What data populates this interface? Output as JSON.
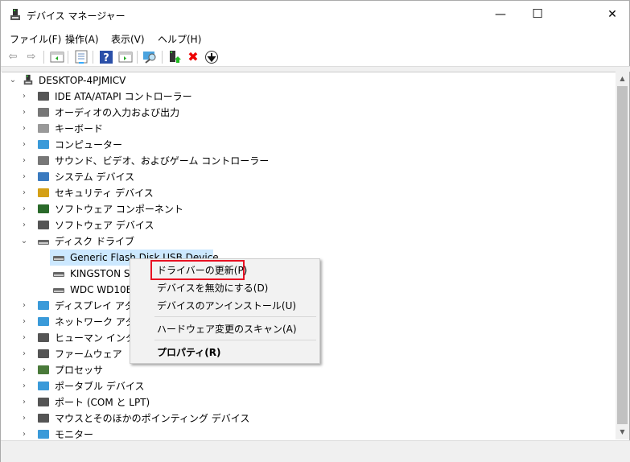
{
  "window": {
    "title": "デバイス マネージャー",
    "minimize": "—",
    "maximize": "☐",
    "close": "✕"
  },
  "menubar": [
    "ファイル(F)",
    "操作(A)",
    "表示(V)",
    "ヘルプ(H)"
  ],
  "toolbar": [
    "back-icon",
    "forward-icon",
    "show-hide-console-tree-icon",
    "properties-icon",
    "help-icon",
    "action-pane-icon",
    "scan-hardware-icon",
    "update-driver-icon",
    "uninstall-icon",
    "disable-icon"
  ],
  "tree": {
    "root": "DESKTOP-4PJMICV",
    "items": [
      {
        "label": "IDE ATA/ATAPI コントローラー",
        "icon": "ide-controller-icon"
      },
      {
        "label": "オーディオの入力および出力",
        "icon": "speaker-icon"
      },
      {
        "label": "キーボード",
        "icon": "keyboard-icon"
      },
      {
        "label": "コンピューター",
        "icon": "computer-icon"
      },
      {
        "label": "サウンド、ビデオ、およびゲーム コントローラー",
        "icon": "speaker-icon"
      },
      {
        "label": "システム デバイス",
        "icon": "system-device-icon"
      },
      {
        "label": "セキュリティ デバイス",
        "icon": "security-key-icon"
      },
      {
        "label": "ソフトウェア コンポーネント",
        "icon": "software-component-icon"
      },
      {
        "label": "ソフトウェア デバイス",
        "icon": "software-device-icon"
      },
      {
        "label": "ディスク ドライブ",
        "icon": "disk-drive-icon",
        "expanded": true
      },
      {
        "label": "Generic Flash Disk USB Device",
        "icon": "disk-drive-icon",
        "child": true,
        "selected": true
      },
      {
        "label": "KINGSTON S",
        "icon": "disk-drive-icon",
        "child": true
      },
      {
        "label": "WDC WD10E",
        "icon": "disk-drive-icon",
        "child": true
      },
      {
        "label": "ディスプレイ アダプタ",
        "icon": "display-adapter-icon"
      },
      {
        "label": "ネットワーク アダプタ",
        "icon": "network-adapter-icon"
      },
      {
        "label": "ヒューマン インターフ",
        "icon": "hid-icon"
      },
      {
        "label": "ファームウェア",
        "icon": "firmware-icon"
      },
      {
        "label": "プロセッサ",
        "icon": "processor-icon"
      },
      {
        "label": "ポータブル デバイス",
        "icon": "portable-device-icon"
      },
      {
        "label": "ポート (COM と LPT)",
        "icon": "port-icon"
      },
      {
        "label": "マウスとそのほかのポインティング デバイス",
        "icon": "mouse-icon"
      },
      {
        "label": "モニター",
        "icon": "monitor-icon"
      }
    ]
  },
  "context_menu": {
    "items": [
      "ドライバーの更新(P)",
      "デバイスを無効にする(D)",
      "デバイスのアンインストール(U)",
      "ハードウェア変更のスキャン(A)",
      "プロパティ(R)"
    ],
    "highlighted": "ドライバーの更新(P)",
    "highlight_color": "#e81123"
  },
  "colors": {
    "selection": "#cce8ff"
  }
}
